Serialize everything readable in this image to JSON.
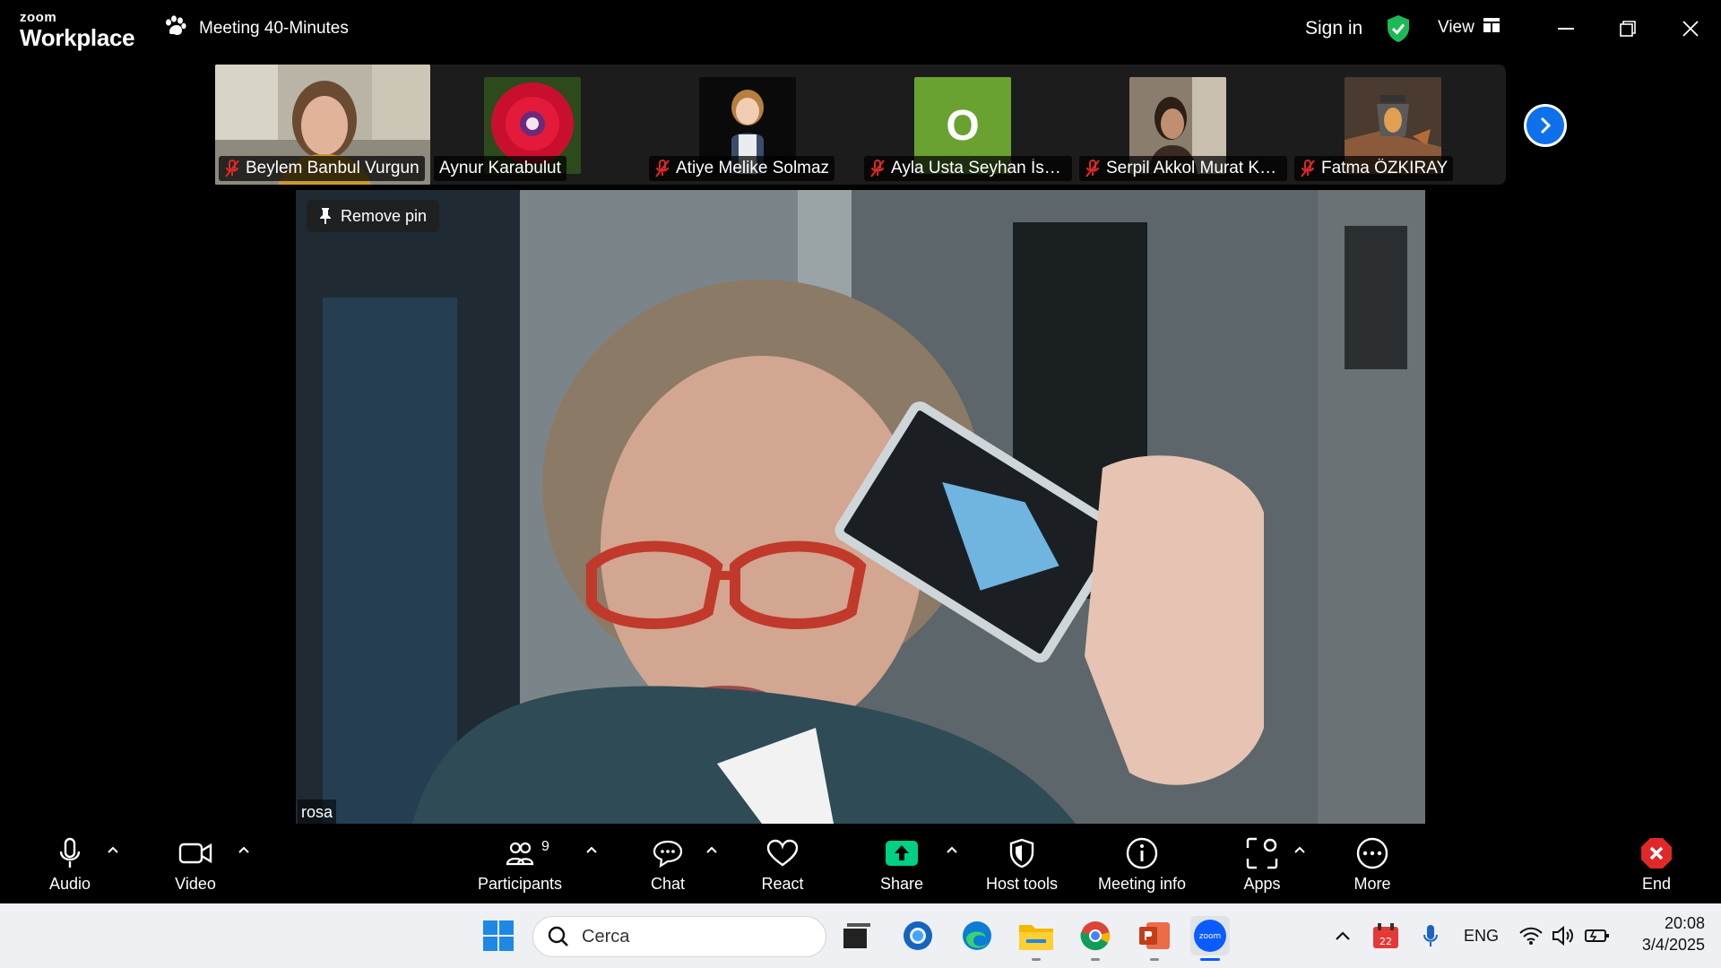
{
  "app": {
    "logo_small": "zoom",
    "logo_big": "Workplace",
    "meeting_title": "Meeting 40-Minutes",
    "sign_in": "Sign in",
    "view": "View"
  },
  "participants_strip": [
    {
      "name": "Beylem Banbul Vurgun",
      "muted": true
    },
    {
      "name": "Aynur Karabulut",
      "muted": false
    },
    {
      "name": "Atiye Melike Solmaz",
      "muted": true
    },
    {
      "name": "Ayla Usta Seyhan İsme...",
      "muted": true,
      "avatar_letter": "O"
    },
    {
      "name": "Serpil Akkol Murat Köl...",
      "muted": true
    },
    {
      "name": "Fatma ÖZKIRAY",
      "muted": true
    }
  ],
  "main_video": {
    "remove_pin": "Remove pin",
    "name": "rosa"
  },
  "toolbar": {
    "audio": "Audio",
    "video": "Video",
    "participants": "Participants",
    "participants_count": "9",
    "chat": "Chat",
    "react": "React",
    "share": "Share",
    "host_tools": "Host tools",
    "meeting_info": "Meeting info",
    "apps": "Apps",
    "more": "More",
    "end": "End"
  },
  "taskbar": {
    "search_placeholder": "Cerca",
    "language": "ENG",
    "time": "20:08",
    "date": "3/4/2025",
    "calendar_badge": "22"
  },
  "colors": {
    "accent_blue": "#0e71eb",
    "share_green": "#00d084",
    "end_red": "#e02828",
    "shield_green": "#1db954"
  }
}
